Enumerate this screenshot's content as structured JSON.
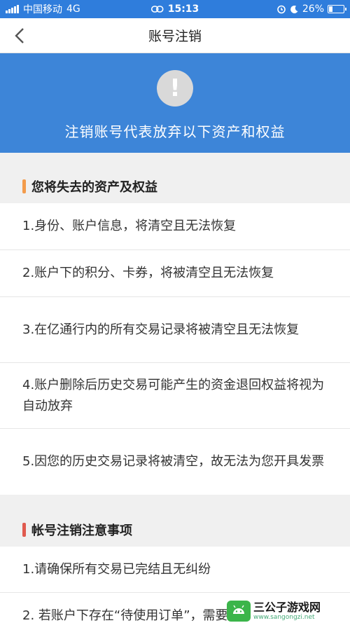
{
  "status_bar": {
    "carrier": "中国移动",
    "network": "4G",
    "time": "15:13",
    "battery": "26%",
    "battery_level": 0.26
  },
  "nav": {
    "title": "账号注销",
    "back_icon": "chevron-left-icon"
  },
  "banner": {
    "icon_text": "!",
    "text": "注销账号代表放弃以下资产和权益"
  },
  "section1": {
    "title": "您将失去的资产及权益",
    "accent_color": "#f39b4b",
    "items": [
      "1.身份、账户信息，将清空且无法恢复",
      "2.账户下的积分、卡券，将被清空且无法恢复",
      "3.在亿通行内的所有交易记录将被清空且无法恢复",
      "4.账户删除后历史交易可能产生的资金退回权益将视为自动放弃",
      "5.因您的历史交易记录将被清空，故无法为您开具发票"
    ]
  },
  "section2": {
    "title": "帐号注销注意事项",
    "accent_color": "#e05a4f",
    "items": [
      "1.请确保所有交易已完结且无纠纷",
      "2. 若账户下存在“待使用订单”，需要"
    ]
  },
  "watermark": {
    "main": "三公子游戏网",
    "sub": "www.sangongzi.net"
  },
  "colors": {
    "status_bar": "#2f7ddc",
    "banner": "#3d85d8",
    "background": "#f0f0f0"
  }
}
